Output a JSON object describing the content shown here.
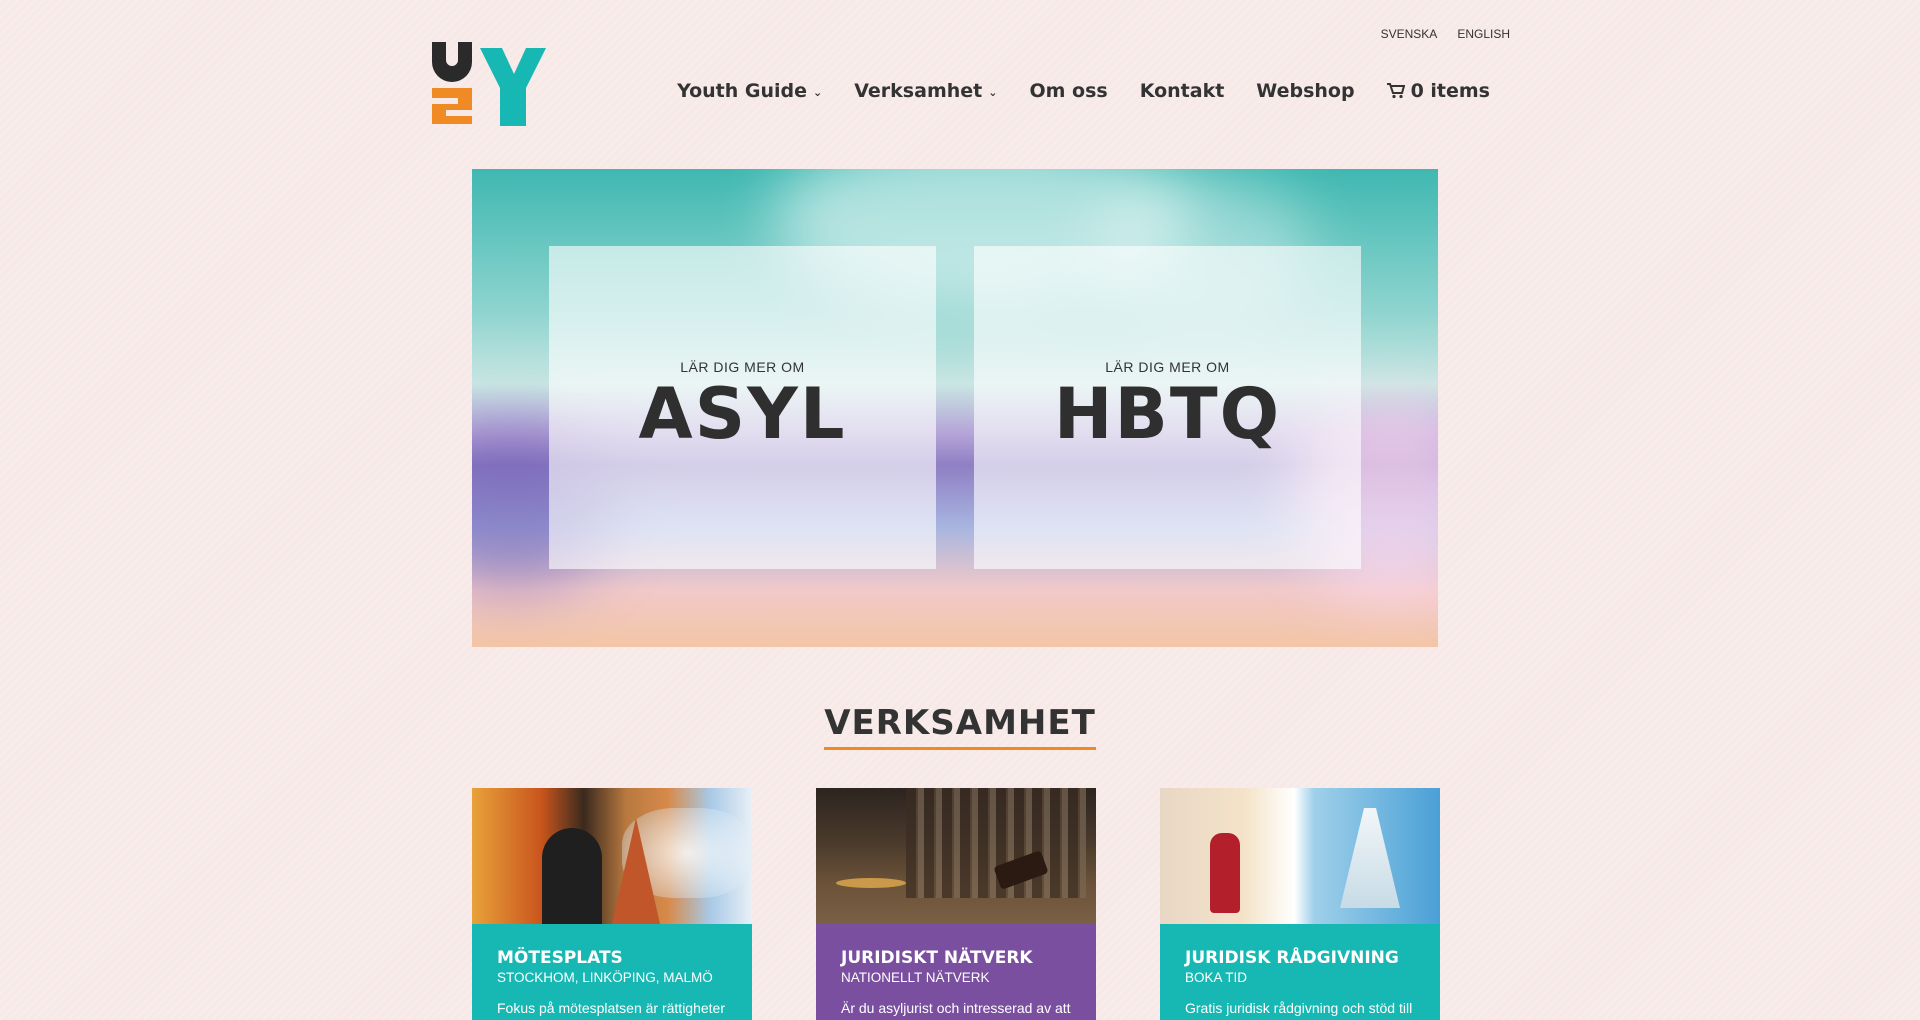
{
  "header": {
    "languages": [
      "SVENSKA",
      "ENGLISH"
    ],
    "logo_alt": "Unga Y logo",
    "nav": [
      {
        "label": "Youth Guide",
        "has_dropdown": true
      },
      {
        "label": "Verksamhet",
        "has_dropdown": true
      },
      {
        "label": "Om oss",
        "has_dropdown": false
      },
      {
        "label": "Kontakt",
        "has_dropdown": false
      },
      {
        "label": "Webshop",
        "has_dropdown": false
      }
    ],
    "cart_label": "0 items"
  },
  "hero": {
    "cards": [
      {
        "kicker": "LÄR DIG MER OM",
        "title": "ASYL"
      },
      {
        "kicker": "LÄR DIG MER OM",
        "title": "HBTQ"
      }
    ]
  },
  "section": {
    "title": "VERKSAMHET"
  },
  "services": [
    {
      "title": "MÖTESPLATS",
      "subtitle": "STOCKHOM, LINKÖPING, MALMÖ",
      "description": "Fokus på mötesplatsen är rättigheter &unga platser och",
      "color": "#17b8b3"
    },
    {
      "title": "JURIDISKT NÄTVERK",
      "subtitle": "NATIONELLT NÄTVERK",
      "description": "Är du asyljurist och intresserad av att stödja unga HBTQ-personer i",
      "color": "#7b4fa0"
    },
    {
      "title": "JURIDISK RÅDGIVNING",
      "subtitle": "BOKA TID",
      "description": "Gratis juridisk rådgivning och stöd till unga asylsökande hbtq-",
      "color": "#17b8b3"
    }
  ],
  "colors": {
    "accent_orange": "#f08a24",
    "teal": "#17b8b3",
    "purple": "#7b4fa0",
    "text": "#333333"
  }
}
